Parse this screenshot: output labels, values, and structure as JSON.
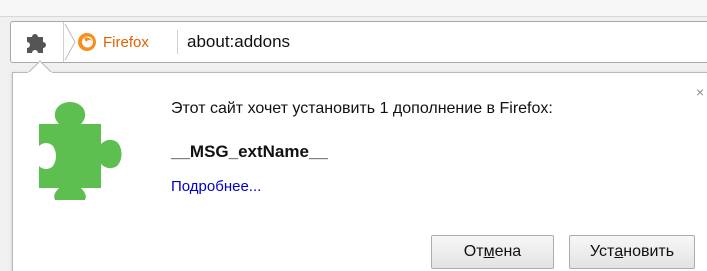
{
  "urlbar": {
    "identity_label": "Firefox",
    "url": "about:addons"
  },
  "panel": {
    "message": "Этот сайт хочет установить 1 дополнение в Firefox:",
    "extension_name": "__MSG_extName__",
    "learn_more": "Подробнее...",
    "close_glyph": "×",
    "buttons": {
      "cancel_pre": "От",
      "cancel_access": "м",
      "cancel_post": "ена",
      "install_pre": "Уст",
      "install_access": "а",
      "install_post": "новить"
    }
  },
  "icons": {
    "addon_small": "puzzle-icon",
    "addon_large": "puzzle-icon",
    "firefox": "firefox-logo-icon"
  },
  "colors": {
    "puzzle_large": "#5cbf4f",
    "puzzle_small": "#555555",
    "firefox_label": "#e66000",
    "link": "#0000cc"
  }
}
